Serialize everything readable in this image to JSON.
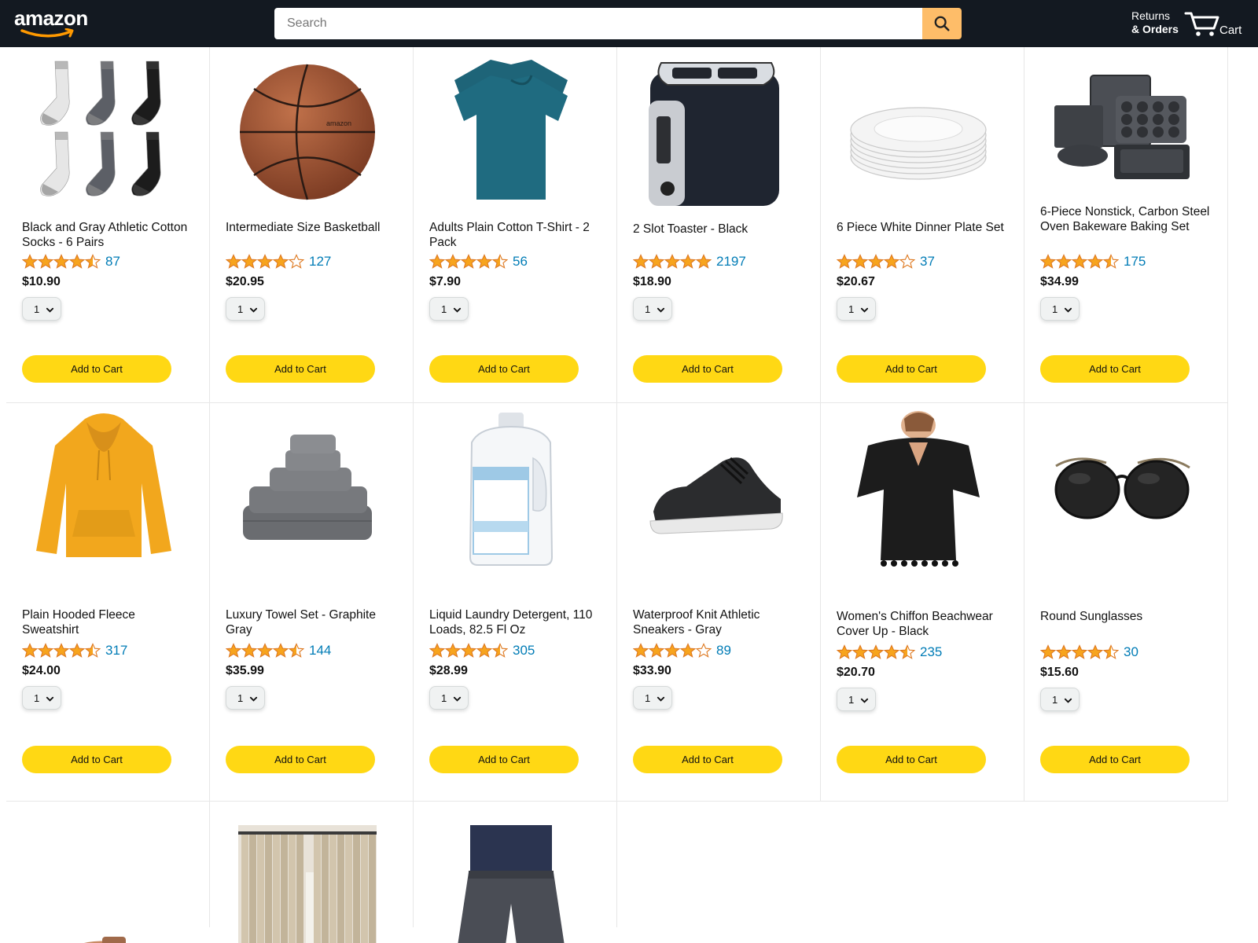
{
  "header": {
    "logo_text": "amazon",
    "search_placeholder": "Search",
    "returns_line1": "Returns",
    "returns_line2": "& Orders",
    "cart_label": "Cart"
  },
  "colors": {
    "header_bg": "#131921",
    "search_button": "#febd69",
    "add_to_cart": "#ffd814",
    "star": "#f7a41d",
    "rating_link": "#017cb6"
  },
  "products": [
    {
      "name": "Black and Gray Athletic Cotton Socks - 6 Pairs",
      "rating": 4.5,
      "count": "87",
      "price": "$10.90",
      "qty": "1",
      "button": "Add to Cart",
      "image": "socks"
    },
    {
      "name": "Intermediate Size Basketball",
      "rating": 4.0,
      "count": "127",
      "price": "$20.95",
      "qty": "1",
      "button": "Add to Cart",
      "image": "basketball"
    },
    {
      "name": "Adults Plain Cotton T-Shirt - 2 Pack",
      "rating": 4.5,
      "count": "56",
      "price": "$7.90",
      "qty": "1",
      "button": "Add to Cart",
      "image": "tshirt"
    },
    {
      "name": "2 Slot Toaster - Black",
      "rating": 5.0,
      "count": "2197",
      "price": "$18.90",
      "qty": "1",
      "button": "Add to Cart",
      "image": "toaster"
    },
    {
      "name": "6 Piece White Dinner Plate Set",
      "rating": 4.0,
      "count": "37",
      "price": "$20.67",
      "qty": "1",
      "button": "Add to Cart",
      "image": "plates"
    },
    {
      "name": "6-Piece Nonstick, Carbon Steel Oven Bakeware Baking Set",
      "rating": 4.5,
      "count": "175",
      "price": "$34.99",
      "qty": "1",
      "button": "Add to Cart",
      "image": "bakeware"
    },
    {
      "name": "Plain Hooded Fleece Sweatshirt",
      "rating": 4.5,
      "count": "317",
      "price": "$24.00",
      "qty": "1",
      "button": "Add to Cart",
      "image": "hoodie"
    },
    {
      "name": "Luxury Towel Set - Graphite Gray",
      "rating": 4.5,
      "count": "144",
      "price": "$35.99",
      "qty": "1",
      "button": "Add to Cart",
      "image": "towels"
    },
    {
      "name": "Liquid Laundry Detergent, 110 Loads, 82.5 Fl Oz",
      "rating": 4.5,
      "count": "305",
      "price": "$28.99",
      "qty": "1",
      "button": "Add to Cart",
      "image": "detergent"
    },
    {
      "name": "Waterproof Knit Athletic Sneakers - Gray",
      "rating": 4.0,
      "count": "89",
      "price": "$33.90",
      "qty": "1",
      "button": "Add to Cart",
      "image": "sneaker"
    },
    {
      "name": "Women's Chiffon Beachwear Cover Up - Black",
      "rating": 4.5,
      "count": "235",
      "price": "$20.70",
      "qty": "1",
      "button": "Add to Cart",
      "image": "coverup"
    },
    {
      "name": "Round Sunglasses",
      "rating": 4.5,
      "count": "30",
      "price": "$15.60",
      "qty": "1",
      "button": "Add to Cart",
      "image": "sunglasses"
    },
    {
      "name": "",
      "rating": 0,
      "count": "",
      "price": "",
      "qty": "",
      "button": "",
      "image": "sandal"
    },
    {
      "name": "",
      "rating": 0,
      "count": "",
      "price": "",
      "qty": "",
      "button": "",
      "image": "curtains"
    },
    {
      "name": "",
      "rating": 0,
      "count": "",
      "price": "",
      "qty": "",
      "button": "",
      "image": "shorts"
    }
  ]
}
